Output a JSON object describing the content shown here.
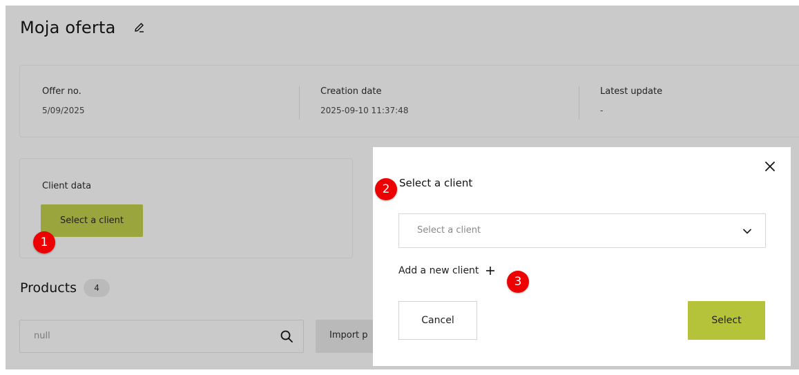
{
  "header": {
    "title": "Moja oferta",
    "edit_icon": "pencil-icon"
  },
  "info": [
    {
      "label": "Offer no.",
      "value": "5/09/2025"
    },
    {
      "label": "Creation date",
      "value": "2025-09-10 11:37:48"
    },
    {
      "label": "Latest update",
      "value": "-"
    }
  ],
  "client": {
    "title": "Client data",
    "button_label": "Select a client"
  },
  "products": {
    "title": "Products",
    "count": "4",
    "search_value": "null",
    "import_label": "Import p"
  },
  "modal": {
    "title": "Select a client",
    "select_placeholder": "Select a client",
    "add_label": "Add a new client",
    "cancel_label": "Cancel",
    "select_label": "Select"
  },
  "markers": [
    "1",
    "2",
    "3"
  ],
  "colors": {
    "overlay": "#cacaca",
    "accent": "#b4c339",
    "accent_dimmed": "#9aa53d",
    "marker": "#ee0000"
  }
}
